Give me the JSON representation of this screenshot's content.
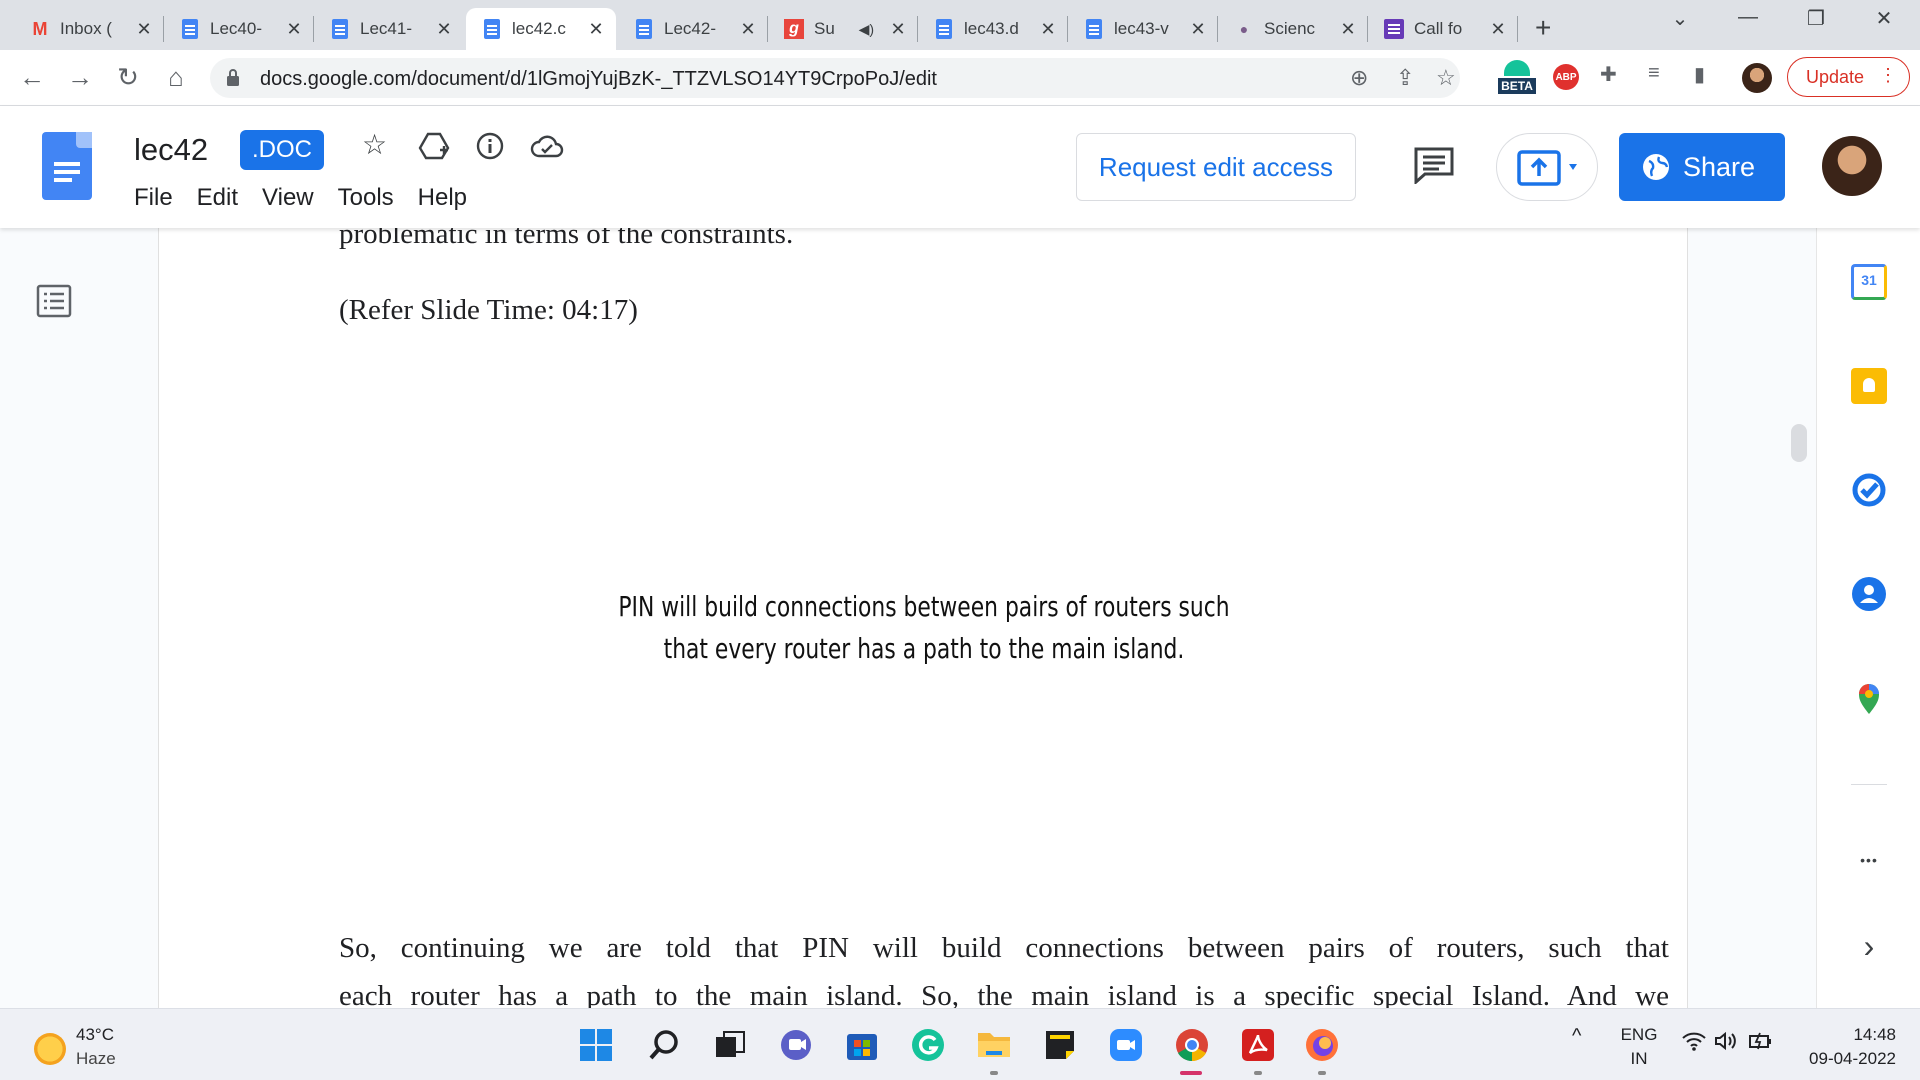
{
  "browser": {
    "tabs": [
      {
        "label": "Inbox (",
        "icon": "gmail-icon",
        "active": false
      },
      {
        "label": "Lec40-",
        "icon": "docs-icon",
        "active": false
      },
      {
        "label": "Lec41-",
        "icon": "docs-icon",
        "active": false
      },
      {
        "label": "lec42.c",
        "icon": "docs-icon",
        "active": true
      },
      {
        "label": "Lec42-",
        "icon": "docs-icon",
        "active": false
      },
      {
        "label": "Su",
        "icon": "g-site-icon",
        "active": false
      },
      {
        "label": "lec43.d",
        "icon": "docs-icon",
        "active": false
      },
      {
        "label": "lec43-v",
        "icon": "docs-icon",
        "active": false
      },
      {
        "label": "Scienc",
        "icon": "brain-icon",
        "active": false
      },
      {
        "label": "Call fo",
        "icon": "forms-icon",
        "active": false
      }
    ],
    "url": "docs.google.com/document/d/1lGmojYujBzK-_TTZVLSO14YT9CrpoPoJ/edit",
    "update_label": "Update",
    "beta_label": "BETA",
    "abp_label": "ABP"
  },
  "docs": {
    "title": "lec42",
    "badge": ".DOC",
    "menu": [
      "File",
      "Edit",
      "View",
      "Tools",
      "Help"
    ],
    "request_edit_label": "Request edit access",
    "share_label": "Share"
  },
  "document": {
    "line_top": "problematic in terms of the constraints.",
    "refer_line": "(Refer Slide Time: 04:17)",
    "slide_line1": "PIN will build connections between pairs of routers such",
    "slide_line2": "that every router has a path to the main island.",
    "para_line1": "So, continuing we are told that PIN will build connections between pairs of routers, such that",
    "para_line2": "each router has a path to the main island. So, the main island is a specific special Island. And we"
  },
  "side_panel": {
    "calendar_day": "31",
    "more_label": "•••",
    "expand_label": "›"
  },
  "taskbar": {
    "temperature": "43°C",
    "weather": "Haze",
    "lang_top": "ENG",
    "lang_bottom": "IN",
    "time": "14:48",
    "date": "09-04-2022"
  },
  "colors": {
    "accent": "#1a73e8",
    "docs_blue": "#4285f4",
    "update_red": "#d93025"
  }
}
